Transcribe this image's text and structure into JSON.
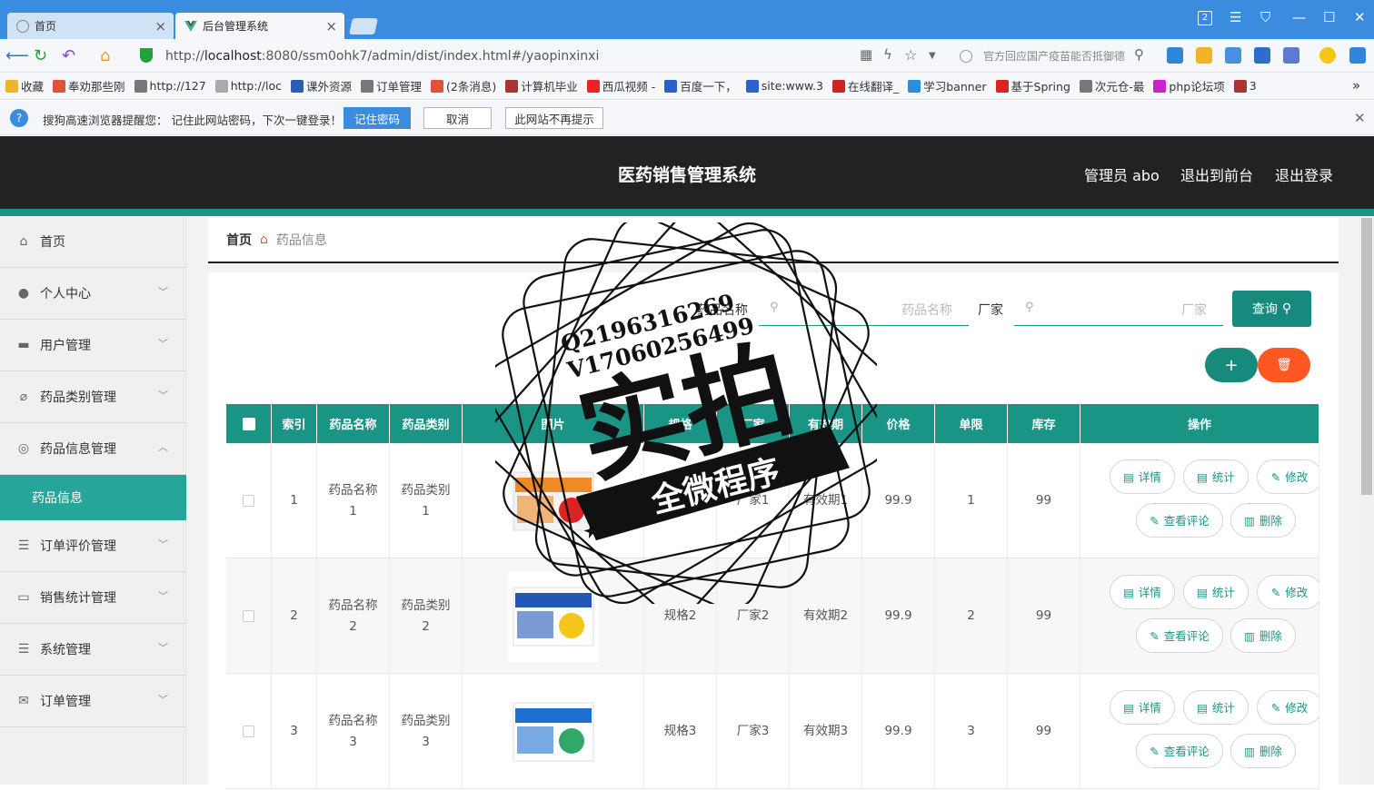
{
  "browser": {
    "tabs": [
      {
        "label": "首页",
        "active": false
      },
      {
        "label": "后台管理系统",
        "active": true
      }
    ],
    "window_badge": "2",
    "url_prefix": "http://",
    "url_host": "localhost",
    "url_rest": ":8080/ssm0ohk7/admin/dist/index.html#/yaopinxinxi",
    "search_placeholder": "官方回应国产疫苗能否抵御德",
    "bookmarks": [
      "收藏",
      "奉劝那些刚",
      "http://127",
      "http://loc",
      "课外资源",
      "订单管理",
      "(2条消息)",
      "计算机毕业",
      "西瓜视频 -",
      "百度一下，",
      "site:www.3",
      "在线翻译_",
      "学习banner",
      "基于Spring",
      "次元仓-最",
      "php论坛项",
      "3"
    ],
    "notice": {
      "text": "搜狗高速浏览器提醒您： 记住此网站密码，下次一键登录！",
      "remember": "记住密码",
      "cancel": "取消",
      "never": "此网站不再提示"
    }
  },
  "header": {
    "title": "医药销售管理系统",
    "admin": "管理员 abo",
    "to_front": "退出到前台",
    "logout": "退出登录"
  },
  "sidebar": {
    "items": [
      {
        "label": "首页",
        "icon": "home-icon"
      },
      {
        "label": "个人中心",
        "icon": "user-icon"
      },
      {
        "label": "用户管理",
        "icon": "monitor-icon"
      },
      {
        "label": "药品类别管理",
        "icon": "bell-off-icon"
      },
      {
        "label": "药品信息管理",
        "icon": "compass-icon"
      },
      {
        "label": "订单评价管理",
        "icon": "list-icon"
      },
      {
        "label": "销售统计管理",
        "icon": "screen-icon"
      },
      {
        "label": "系统管理",
        "icon": "menu-icon"
      },
      {
        "label": "订单管理",
        "icon": "mail-icon"
      }
    ],
    "sub_active": "药品信息"
  },
  "breadcrumb": {
    "home": "首页",
    "current": "药品信息"
  },
  "search": {
    "name_label": "药品名称",
    "name_placeholder": "药品名称",
    "maker_label": "厂家",
    "maker_placeholder": "厂家",
    "query": "查询"
  },
  "actions": {
    "add": "+",
    "delete": "🗑"
  },
  "table": {
    "headers": [
      "索引",
      "药品名称",
      "药品类别",
      "图片",
      "规格",
      "厂家",
      "有效期",
      "价格",
      "单限",
      "库存",
      "操作"
    ],
    "rows": [
      {
        "index": "1",
        "name": "药品名称\n1",
        "category": "药品类别\n1",
        "spec": "规格1",
        "maker": "厂家1",
        "expiry": "有效期1",
        "price": "99.9",
        "limit": "1",
        "stock": "99"
      },
      {
        "index": "2",
        "name": "药品名称\n2",
        "category": "药品类别\n2",
        "spec": "规格2",
        "maker": "厂家2",
        "expiry": "有效期2",
        "price": "99.9",
        "limit": "2",
        "stock": "99"
      },
      {
        "index": "3",
        "name": "药品名称\n3",
        "category": "药品类别\n3",
        "spec": "规格3",
        "maker": "厂家3",
        "expiry": "有效期3",
        "price": "99.9",
        "limit": "3",
        "stock": "99"
      }
    ],
    "ops": {
      "detail": "详情",
      "stats": "统计",
      "edit": "修改",
      "comments": "查看评论",
      "remove": "删除"
    }
  },
  "watermark": {
    "qq": "Q2196316269",
    "v": "V17060256499",
    "big": "实拍",
    "banner": "全微程序"
  },
  "colors": {
    "teal": "#1a9485",
    "orange": "#ff5722",
    "header": "#222222"
  }
}
